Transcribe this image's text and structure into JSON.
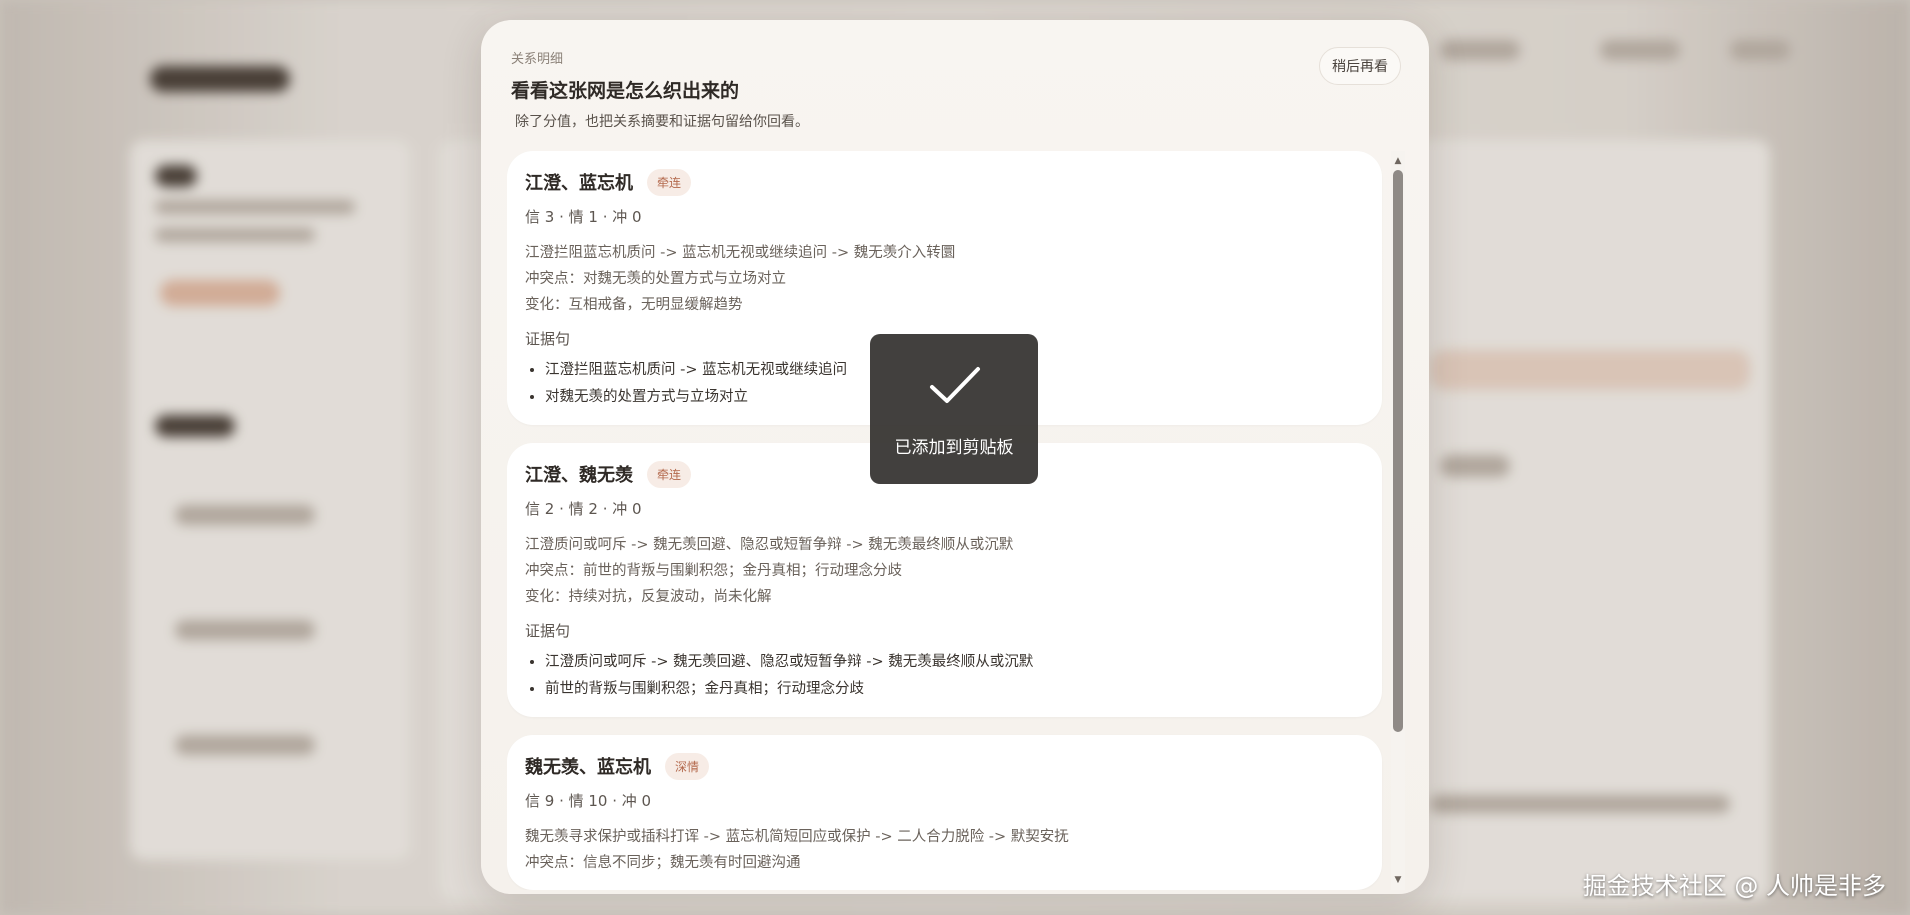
{
  "modal": {
    "eyebrow": "关系明细",
    "title": "看看这张网是怎么织出来的",
    "subtitle": "除了分值，也把关系摘要和证据句留给你回看。",
    "later_button": "稍后再看"
  },
  "cards": [
    {
      "title": "江澄、蓝忘机",
      "tag": "牵连",
      "score": "信 3 · 情 1 · 冲 0",
      "lines": [
        "江澄拦阻蓝忘机质问 -> 蓝忘机无视或继续追问 -> 魏无羡介入转圜",
        "冲突点：对魏无羡的处置方式与立场对立",
        "变化：互相戒备，无明显缓解趋势"
      ],
      "evidence_title": "证据句",
      "evidence": [
        "江澄拦阻蓝忘机质问 -> 蓝忘机无视或继续追问",
        "对魏无羡的处置方式与立场对立"
      ]
    },
    {
      "title": "江澄、魏无羡",
      "tag": "牵连",
      "score": "信 2 · 情 2 · 冲 0",
      "lines": [
        "江澄质问或呵斥 -> 魏无羡回避、隐忍或短暂争辩 -> 魏无羡最终顺从或沉默",
        "冲突点：前世的背叛与围剿积怨；金丹真相；行动理念分歧",
        "变化：持续对抗，反复波动，尚未化解"
      ],
      "evidence_title": "证据句",
      "evidence": [
        "江澄质问或呵斥 -> 魏无羡回避、隐忍或短暂争辩 -> 魏无羡最终顺从或沉默",
        "前世的背叛与围剿积怨；金丹真相；行动理念分歧"
      ]
    },
    {
      "title": "魏无羡、蓝忘机",
      "tag": "深情",
      "score": "信 9 · 情 10 · 冲 0",
      "lines": [
        "魏无羡寻求保护或插科打诨 -> 蓝忘机简短回应或保护 -> 二人合力脱险 -> 默契安抚",
        "冲突点：信息不同步；魏无羡有时回避沟通"
      ],
      "evidence_title": "",
      "evidence": []
    }
  ],
  "toast": {
    "icon": "checkmark-icon",
    "text": "已添加到剪贴板"
  },
  "watermark": "掘金技术社区 @ 人帅是非多",
  "scrollbar": {
    "up_arrow": "▲",
    "down_arrow": "▼"
  }
}
